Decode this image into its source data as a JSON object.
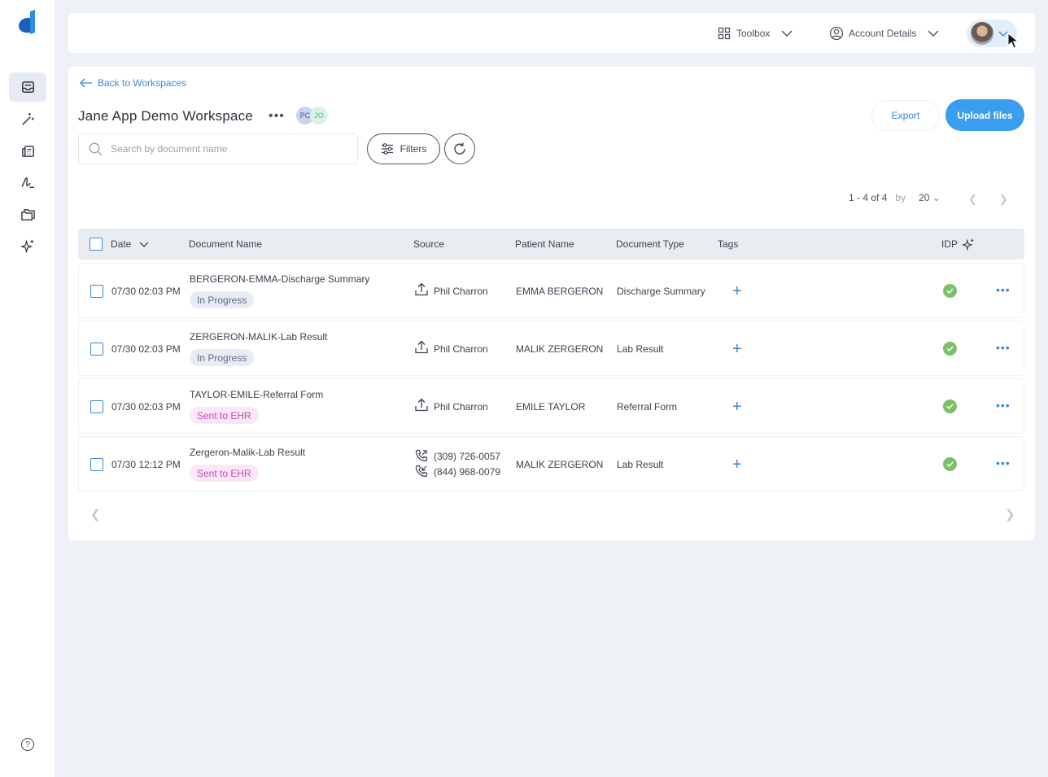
{
  "header": {
    "toolbox_label": "Toolbox",
    "account_label": "Account Details"
  },
  "workspace": {
    "back_label": "Back to Workspaces",
    "title": "Jane App Demo Workspace",
    "members": [
      "PC",
      "JO"
    ],
    "export_label": "Export",
    "upload_label": "Upload files"
  },
  "search": {
    "placeholder": "Search by document name"
  },
  "filters_label": "Filters",
  "pagination": {
    "range": "1 - 4 of 4",
    "by_label": "by",
    "page_size": "20"
  },
  "table": {
    "columns": [
      "Date",
      "Document Name",
      "Source",
      "Patient Name",
      "Document Type",
      "Tags",
      "IDP"
    ],
    "rows": [
      {
        "date": "07/30 02:03 PM",
        "name": "BERGERON-EMMA-Discharge Summary",
        "status": "In Progress",
        "source": [
          "Phil Charron"
        ],
        "patient": "EMMA BERGERON",
        "type": "Discharge Summary"
      },
      {
        "date": "07/30 02:03 PM",
        "name": "ZERGERON-MALIK-Lab Result",
        "status": "In Progress",
        "source": [
          "Phil Charron"
        ],
        "patient": "MALIK ZERGERON",
        "type": "Lab Result"
      },
      {
        "date": "07/30 02:03 PM",
        "name": "TAYLOR-EMILE-Referral Form",
        "status": "Sent to EHR",
        "source": [
          "Phil Charron"
        ],
        "patient": "EMILE TAYLOR",
        "type": "Referral Form"
      },
      {
        "date": "07/30 12:12 PM",
        "name": "Zergeron-Malik-Lab Result",
        "status": "Sent to EHR",
        "source": [
          "(309) 726-0057",
          "(844) 968-0079"
        ],
        "patient": "MALIK ZERGERON",
        "type": "Lab Result"
      }
    ]
  },
  "colors": {
    "accent": "#3a9ded",
    "link": "#3a8ad6",
    "success": "#7dc06a",
    "ehr": "#c24cb6"
  },
  "icons": [
    "logo-icon",
    "inbox-icon",
    "magic-wand-icon",
    "fax-icon",
    "signature-icon",
    "folders-icon",
    "sparkles-icon",
    "help-icon",
    "grid-icon",
    "user-circle-icon",
    "upload-icon",
    "phone-incoming-icon",
    "phone-outgoing-icon",
    "check-circle-icon"
  ]
}
